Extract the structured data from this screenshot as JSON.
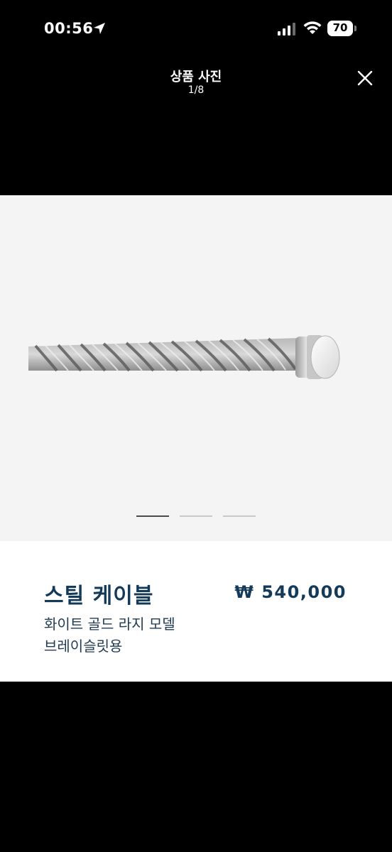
{
  "status_bar": {
    "time": "00:56",
    "battery": "70",
    "icons": [
      "location-arrow-icon",
      "cellular-signal-icon",
      "wifi-icon",
      "battery-icon"
    ]
  },
  "header": {
    "title": "상품 사진",
    "counter": "1/8",
    "close_icon": "close-icon"
  },
  "gallery": {
    "total_indicator_dots": 3,
    "active_index": 0
  },
  "product": {
    "name": "스틸 케이블",
    "price": "₩ 540,000",
    "description": "화이트 골드 라지 모델 브레이슬릿용"
  },
  "colors": {
    "background": "#000000",
    "photo_background": "#f4f4f4",
    "text_accent": "#143a5a"
  }
}
